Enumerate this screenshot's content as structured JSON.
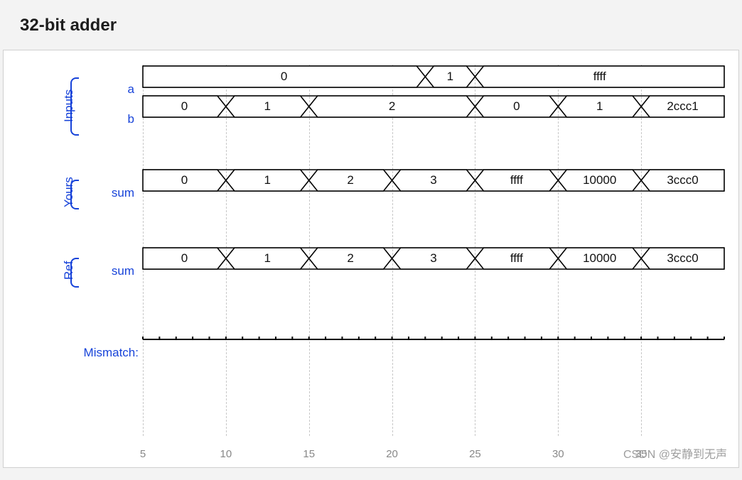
{
  "title": "32-bit adder",
  "chart_data": {
    "type": "table",
    "x_ticks": [
      5,
      10,
      15,
      20,
      25,
      30,
      35
    ],
    "groups": [
      {
        "label": "Inputs",
        "signals": [
          {
            "name": "a",
            "segments": [
              {
                "from": 5,
                "to": 22,
                "value": "0"
              },
              {
                "from": 22,
                "to": 25,
                "value": "1"
              },
              {
                "from": 25,
                "to": 40,
                "value": "ffff"
              }
            ]
          },
          {
            "name": "b",
            "segments": [
              {
                "from": 5,
                "to": 10,
                "value": "0"
              },
              {
                "from": 10,
                "to": 15,
                "value": "1"
              },
              {
                "from": 15,
                "to": 25,
                "value": "2"
              },
              {
                "from": 25,
                "to": 30,
                "value": "0"
              },
              {
                "from": 30,
                "to": 35,
                "value": "1"
              },
              {
                "from": 35,
                "to": 40,
                "value": "2ccc1"
              }
            ]
          }
        ]
      },
      {
        "label": "Yours",
        "signals": [
          {
            "name": "sum",
            "segments": [
              {
                "from": 5,
                "to": 10,
                "value": "0"
              },
              {
                "from": 10,
                "to": 15,
                "value": "1"
              },
              {
                "from": 15,
                "to": 20,
                "value": "2"
              },
              {
                "from": 20,
                "to": 25,
                "value": "3"
              },
              {
                "from": 25,
                "to": 30,
                "value": "ffff"
              },
              {
                "from": 30,
                "to": 35,
                "value": "10000"
              },
              {
                "from": 35,
                "to": 40,
                "value": "3ccc0"
              }
            ]
          }
        ]
      },
      {
        "label": "Ref",
        "signals": [
          {
            "name": "sum",
            "segments": [
              {
                "from": 5,
                "to": 10,
                "value": "0"
              },
              {
                "from": 10,
                "to": 15,
                "value": "1"
              },
              {
                "from": 15,
                "to": 20,
                "value": "2"
              },
              {
                "from": 20,
                "to": 25,
                "value": "3"
              },
              {
                "from": 25,
                "to": 30,
                "value": "ffff"
              },
              {
                "from": 30,
                "to": 35,
                "value": "10000"
              },
              {
                "from": 35,
                "to": 40,
                "value": "3ccc0"
              }
            ]
          }
        ]
      }
    ],
    "mismatch_label": "Mismatch:"
  },
  "watermark": "CSDN @安静到无声"
}
